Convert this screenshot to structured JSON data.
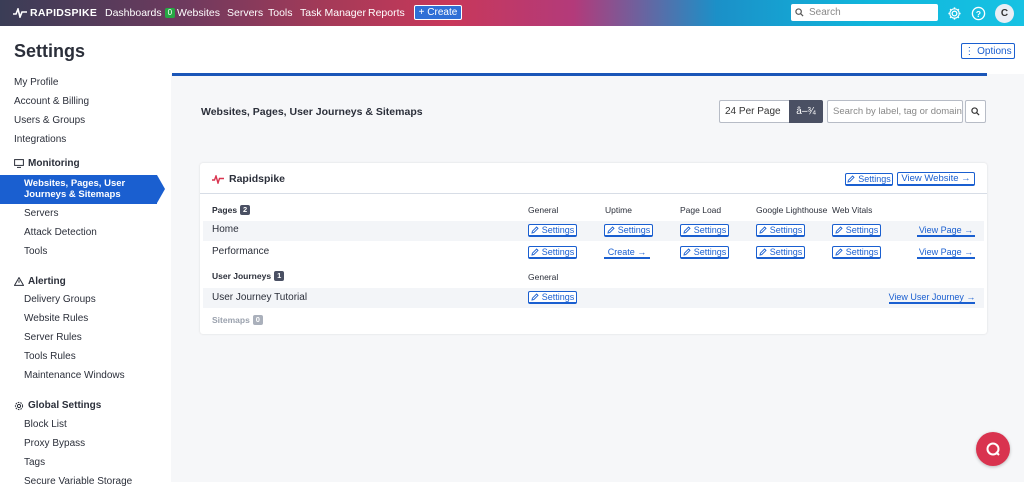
{
  "topbar": {
    "brand": "RAPIDSPIKE",
    "nav": {
      "dashboards": "Dashboards",
      "dashboards_badge": "0",
      "websites": "Websites",
      "servers": "Servers",
      "tools": "Tools",
      "task_manager": "Task Manager",
      "reports": "Reports"
    },
    "create_label": "+ Create",
    "search_placeholder": "Search",
    "avatar_initial": "C"
  },
  "sidebar": {
    "title": "Settings",
    "top_items": [
      "My Profile",
      "Account & Billing",
      "Users & Groups",
      "Integrations"
    ],
    "monitoring": {
      "heading": "Monitoring",
      "active_item": "Websites, Pages, User Journeys & Sitemaps",
      "active_line1": "Websites, Pages, User",
      "active_line2": "Journeys & Sitemaps",
      "items": [
        "Servers",
        "Attack Detection",
        "Tools"
      ]
    },
    "alerting": {
      "heading": "Alerting",
      "items": [
        "Delivery Groups",
        "Website Rules",
        "Server Rules",
        "Tools Rules",
        "Maintenance Windows"
      ]
    },
    "global": {
      "heading": "Global Settings",
      "items": [
        "Block List",
        "Proxy Bypass",
        "Tags",
        "Secure Variable Storage"
      ]
    }
  },
  "main": {
    "options_label": "⋮ Options",
    "section_title": "Websites, Pages, User Journeys & Sitemaps",
    "per_page_value": "24 Per Page",
    "per_page_button": "â–¾",
    "search_placeholder": "Search by label, tag or domain"
  },
  "website_card": {
    "name": "Rapidspike",
    "settings_label": "Settings",
    "view_website_label": "View Website →",
    "pages": {
      "label": "Pages",
      "count": "2",
      "columns": [
        "General",
        "Uptime",
        "Page Load",
        "Google Lighthouse",
        "Web Vitals"
      ],
      "rows": [
        {
          "name": "Home",
          "general": "Settings",
          "uptime": "Settings",
          "page_load": "Settings",
          "lighthouse": "Settings",
          "web_vitals": "Settings",
          "view": "View Page →"
        },
        {
          "name": "Performance",
          "general": "Settings",
          "uptime": "Create →",
          "page_load": "Settings",
          "lighthouse": "Settings",
          "web_vitals": "Settings",
          "view": "View Page →"
        }
      ]
    },
    "user_journeys": {
      "label": "User Journeys",
      "count": "1",
      "column": "General",
      "rows": [
        {
          "name": "User Journey Tutorial",
          "general": "Settings",
          "view": "View User Journey →"
        }
      ]
    },
    "sitemaps": {
      "label": "Sitemaps",
      "count": "0"
    }
  },
  "colors": {
    "accent": "#1a5fd0",
    "fab": "#d9334f",
    "badge_green": "#27a844"
  }
}
